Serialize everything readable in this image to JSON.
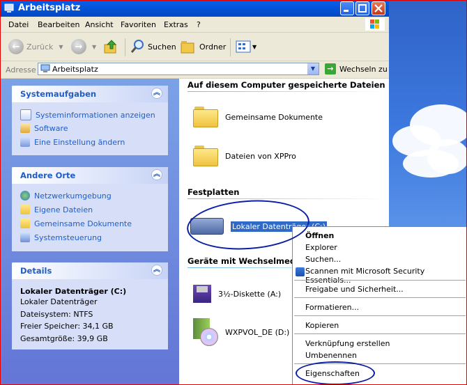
{
  "window": {
    "title": "Arbeitsplatz"
  },
  "menubar": {
    "items": [
      "Datei",
      "Bearbeiten",
      "Ansicht",
      "Favoriten",
      "Extras",
      "?"
    ]
  },
  "toolbar": {
    "back": "Zurück",
    "search": "Suchen",
    "folders": "Ordner"
  },
  "address": {
    "label": "Adresse",
    "value": "Arbeitsplatz",
    "go": "Wechseln zu"
  },
  "left": {
    "system": {
      "title": "Systemaufgaben",
      "links": [
        "Systeminformationen anzeigen",
        "Software",
        "Eine Einstellung ändern"
      ]
    },
    "places": {
      "title": "Andere Orte",
      "links": [
        "Netzwerkumgebung",
        "Eigene Dateien",
        "Gemeinsame Dokumente",
        "Systemsteuerung"
      ]
    },
    "details": {
      "title": "Details",
      "name": "Lokaler Datenträger (C:)",
      "type": "Lokaler Datenträger",
      "fs": "Dateisystem: NTFS",
      "free": "Freier Speicher: 34,1 GB",
      "total": "Gesamtgröße: 39,9 GB"
    }
  },
  "content": {
    "stored": {
      "title": "Auf diesem Computer gespeicherte Dateien",
      "items": [
        "Gemeinsame Dokumente",
        "Dateien von XPPro"
      ]
    },
    "drives": {
      "title": "Festplatten",
      "items": [
        "Lokaler Datenträger (C:)"
      ]
    },
    "removable": {
      "title": "Geräte mit Wechselmedien",
      "items": [
        "3½-Diskette (A:)",
        "WXPVOL_DE (D:)"
      ]
    }
  },
  "context_menu": {
    "items": [
      "Öffnen",
      "Explorer",
      "Suchen...",
      "Scannen mit Microsoft Security Essentials...",
      "Freigabe und Sicherheit...",
      "Formatieren...",
      "Kopieren",
      "Verknüpfung erstellen",
      "Umbenennen",
      "Eigenschaften"
    ]
  },
  "colors": {
    "title_bar": "#0556dc",
    "link": "#215dc6",
    "selection": "#316ac5",
    "annotation_ink": "#0a1fa5"
  }
}
